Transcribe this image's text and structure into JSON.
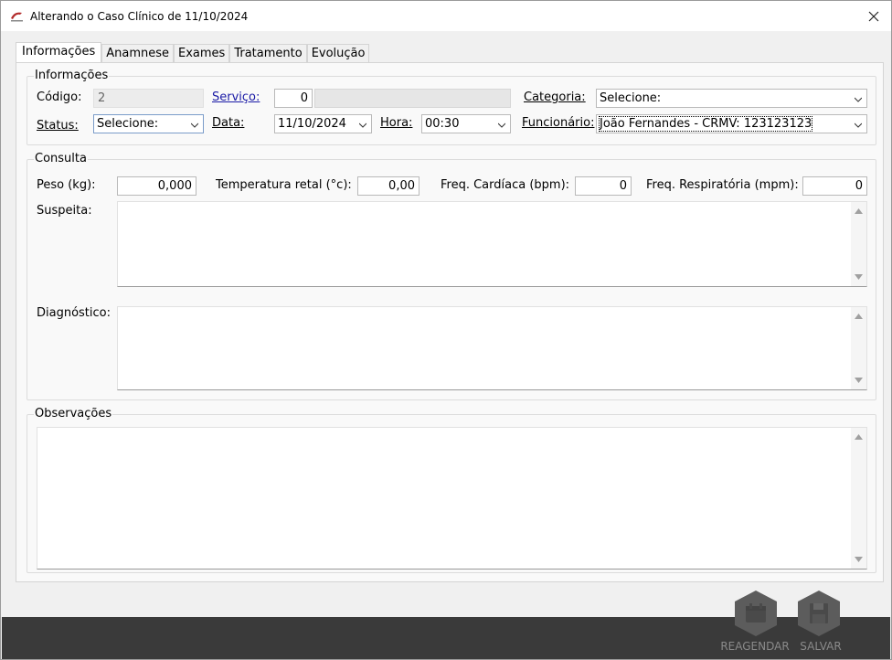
{
  "window": {
    "title": "Alterando o Caso Clínico de 11/10/2024"
  },
  "tabs": [
    {
      "label": "Informações",
      "active": true
    },
    {
      "label": "Anamnese"
    },
    {
      "label": "Exames"
    },
    {
      "label": "Tratamento"
    },
    {
      "label": "Evolução"
    }
  ],
  "informacoes": {
    "group_label": "Informações",
    "codigo_label": "Código:",
    "codigo_value": "2",
    "servico_label": "Serviço:",
    "servico_value": "0",
    "categoria_label": "Categoria:",
    "categoria_value": "Selecione:",
    "status_label": "Status:",
    "status_value": "Selecione:",
    "data_label": "Data:",
    "data_value": "11/10/2024",
    "hora_label": "Hora:",
    "hora_value": "00:30",
    "funcionario_label": "Funcionário:",
    "funcionario_value": "João Fernandes - CRMV: 123123123"
  },
  "consulta": {
    "group_label": "Consulta",
    "peso_label": "Peso (kg):",
    "peso_value": "0,000",
    "temperatura_label": "Temperatura retal (°c):",
    "temperatura_value": "0,00",
    "freq_cardiaca_label": "Freq. Cardíaca (bpm):",
    "freq_cardiaca_value": "0",
    "freq_respiratoria_label": "Freq. Respiratória (mpm):",
    "freq_respiratoria_value": "0",
    "suspeita_label": "Suspeita:",
    "suspeita_value": "",
    "diagnostico_label": "Diagnóstico:",
    "diagnostico_value": ""
  },
  "observacoes": {
    "group_label": "Observações",
    "value": ""
  },
  "footer": {
    "reagendar_label": "REAGENDAR",
    "salvar_label": "SALVAR"
  },
  "colors": {
    "footer_bg": "#3a3a3a",
    "link": "#1a1aa6",
    "action_hex": "#5c5c5c"
  },
  "icons": {
    "app": "app-logo-icon",
    "close": "close-icon",
    "reagendar": "calendar-icon",
    "salvar": "floppy-disk-icon"
  }
}
